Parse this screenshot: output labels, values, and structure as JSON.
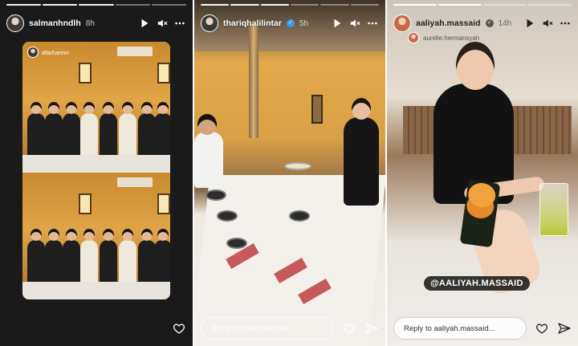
{
  "stories": [
    {
      "username": "salmanhndlh",
      "time": "8h",
      "tagged_user": "afarhannn",
      "segments_done": 3,
      "segments_total": 5,
      "reply_placeholder": ""
    },
    {
      "username": "thariqhalilintar",
      "time": "5h",
      "verified": true,
      "segments_done": 3,
      "segments_total": 6,
      "reply_placeholder": "Reply to thariqhalilintar..."
    },
    {
      "username": "aaliyah.massaid",
      "time": "14h",
      "verified": true,
      "sub_user": "aurelie.hermansyah",
      "mention": "@AALIYAH.MASSAID",
      "segments_done": 2,
      "segments_total": 4,
      "reply_placeholder": "Reply to aaliyah.massaid..."
    }
  ],
  "icons": {
    "play": "play-icon",
    "mute": "muted-speaker-icon",
    "more": "more-dots-icon",
    "like": "heart-icon",
    "share": "send-icon"
  }
}
